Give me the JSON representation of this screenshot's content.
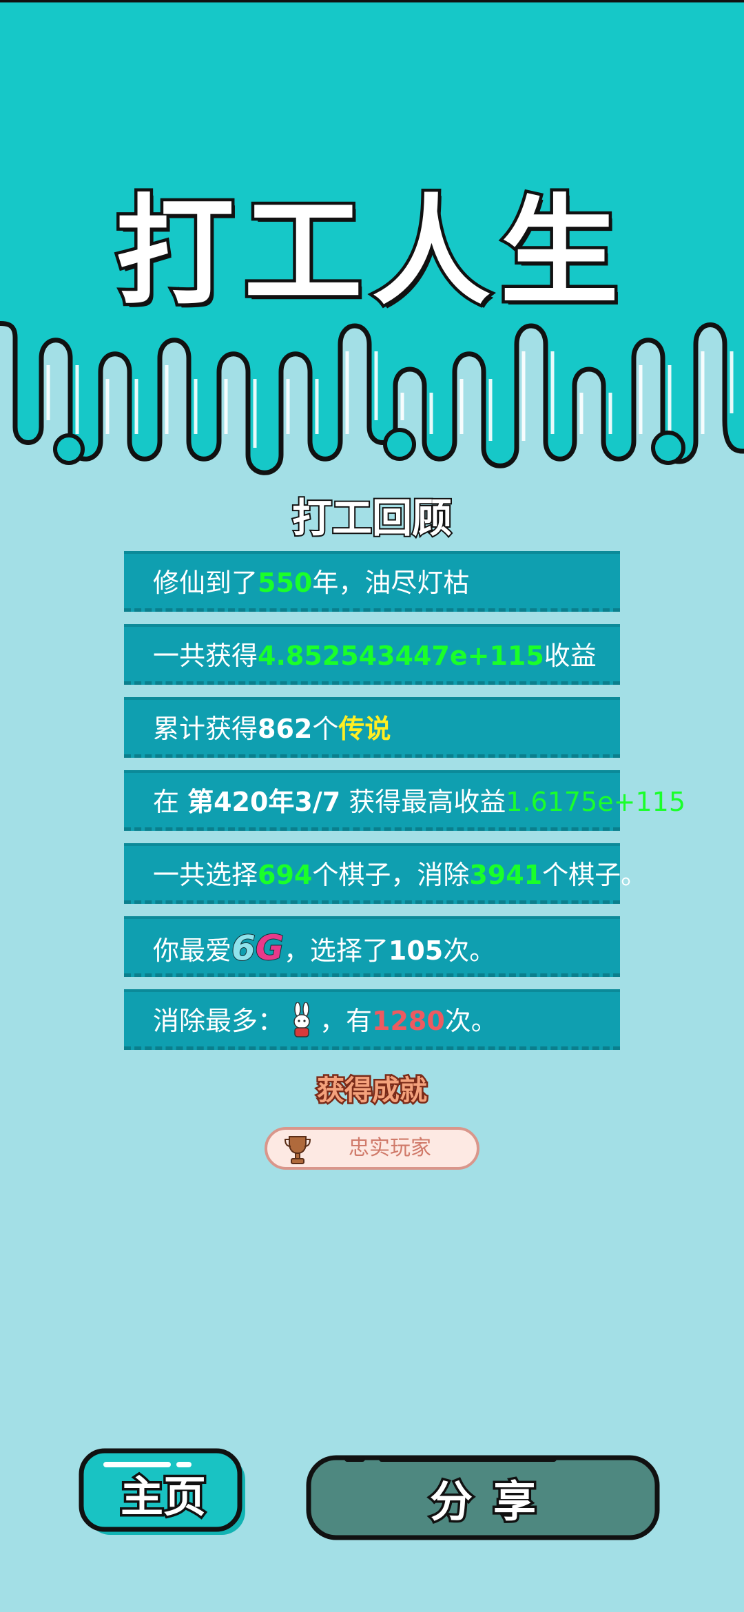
{
  "title": "打工人生",
  "review": {
    "heading": "打工回顾",
    "row1": {
      "a": "修仙到了",
      "years": "550",
      "b": "年，油尽灯枯"
    },
    "row2": {
      "a": "一共获得",
      "income": "4.852543447e+115",
      "b": "收益"
    },
    "row3": {
      "a": "累计获得",
      "count": "862",
      "b": "个",
      "rarity": "传说"
    },
    "row4": {
      "a": "在 ",
      "when": "第420年3/7",
      "b": " 获得最高收益",
      "max": "1.6175e+115"
    },
    "row5": {
      "a": "一共选择",
      "chosen": "694",
      "b": "个棋子，消除",
      "removed": "3941",
      "c": "个棋子。"
    },
    "row6": {
      "a": "你最爱",
      "fav_6": "6",
      "fav_g": "G",
      "b": "，选择了",
      "times": "105",
      "c": "次。"
    },
    "row7": {
      "a": "消除最多：",
      "piece_icon": "rabbit-icon",
      "b": "，有",
      "times": "1280",
      "c": "次。"
    }
  },
  "achievements": {
    "heading": "获得成就",
    "items": [
      {
        "icon": "trophy-icon",
        "label": "忠实玩家"
      }
    ]
  },
  "buttons": {
    "home": "主页",
    "share": "分享"
  },
  "colors": {
    "bg": "#a3dfe6",
    "top": "#16c8c8",
    "row": "#0f9fb0",
    "green": "#1aff2a",
    "yellow": "#ffee22",
    "red": "#ee5a60",
    "home_btn": "#19c3c3",
    "share_btn": "#4e8880"
  }
}
